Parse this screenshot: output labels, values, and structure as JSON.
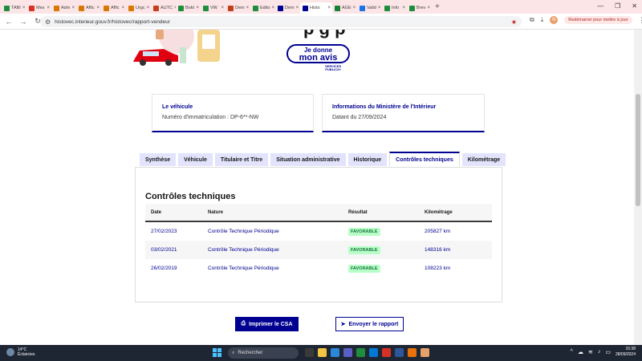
{
  "browser": {
    "tabs": [
      {
        "label": "TABI",
        "icon": "sheets-icon",
        "color": "#1e8e3e"
      },
      {
        "label": "Mes",
        "icon": "gmail-icon",
        "color": "#d93025"
      },
      {
        "label": "Adm",
        "icon": "orange-icon",
        "color": "#d97706"
      },
      {
        "label": "Affic",
        "icon": "orange-icon",
        "color": "#d97706"
      },
      {
        "label": "Affic",
        "icon": "orange-icon",
        "color": "#d97706"
      },
      {
        "label": "Urgc",
        "icon": "orange-icon",
        "color": "#d97706"
      },
      {
        "label": "AUTC",
        "icon": "ppt-icon",
        "color": "#c43e1c"
      },
      {
        "label": "Bokt",
        "icon": "sheets-icon",
        "color": "#1e8e3e"
      },
      {
        "label": "VW",
        "icon": "sheets-icon",
        "color": "#1e8e3e"
      },
      {
        "label": "Dem",
        "icon": "ppt-icon",
        "color": "#c43e1c"
      },
      {
        "label": "Edito",
        "icon": "sheets-icon",
        "color": "#1e8e3e"
      },
      {
        "label": "Dem",
        "icon": "france-flag-icon",
        "color": "#000091"
      },
      {
        "label": "Histo",
        "icon": "france-flag-icon",
        "color": "#000091",
        "active": true
      },
      {
        "label": "AGE",
        "icon": "drive-icon",
        "color": "#188038"
      },
      {
        "label": "Valid",
        "icon": "docs-icon",
        "color": "#1a73e8"
      },
      {
        "label": "Info",
        "icon": "sheets-icon",
        "color": "#1e8e3e"
      },
      {
        "label": "Brev",
        "icon": "sheets-icon",
        "color": "#1e8e3e"
      }
    ],
    "url": "histovec.interieur.gouv.fr/histovec/rapport-vendeur",
    "profile_initial": "N",
    "restart_label": "Redémarrer pour mettre à jour"
  },
  "hero": {
    "heading_fragment": "p    g        p",
    "avis_line1": "Je donne",
    "avis_line2": "mon avis",
    "services_line1": "SERVICES",
    "services_line2": "PUBLICS+"
  },
  "cards": {
    "vehicle": {
      "title": "Le véhicule",
      "value": "Numéro d'immatriculation : DP-6**-NW"
    },
    "ministry": {
      "title": "Informations du Ministère de l'Intérieur",
      "value": "Datant du 27/09/2024"
    }
  },
  "tabs": [
    "Synthèse",
    "Véhicule",
    "Titulaire et Titre",
    "Situation administrative",
    "Historique",
    "Contrôles techniques",
    "Kilométrage"
  ],
  "panel": {
    "title": "Contrôles techniques",
    "columns": [
      "Date",
      "Nature",
      "Résultat",
      "Kilométrage"
    ],
    "rows": [
      {
        "date": "27/02/2023",
        "nature": "Contrôle Technique Périodique",
        "result": "FAVORABLE",
        "km": "205827 km"
      },
      {
        "date": "03/02/2021",
        "nature": "Contrôle Technique Périodique",
        "result": "FAVORABLE",
        "km": "148316 km"
      },
      {
        "date": "26/02/2019",
        "nature": "Contrôle Technique Périodique",
        "result": "FAVORABLE",
        "km": "108223 km"
      }
    ]
  },
  "actions": {
    "print_label": "Imprimer le CSA",
    "send_label": "Envoyer le rapport"
  },
  "taskbar": {
    "temp": "14°C",
    "weather": "Éclaircies",
    "search_placeholder": "Rechercher",
    "time": "15:38",
    "date": "28/09/2024"
  }
}
